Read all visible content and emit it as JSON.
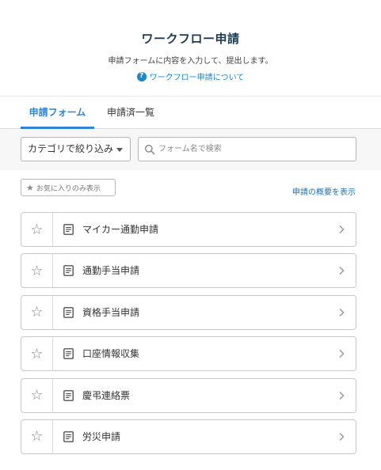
{
  "header": {
    "title": "ワークフロー申請",
    "subtitle": "申請フォームに内容を入力して、提出します。",
    "help_link": "ワークフロー申請について"
  },
  "tabs": [
    {
      "label": "申請フォーム",
      "active": true
    },
    {
      "label": "申請済一覧",
      "active": false
    }
  ],
  "filter": {
    "category_label": "カテゴリで絞り込み",
    "search_placeholder": "フォーム名で検索"
  },
  "favorites_filter_label": "お気に入りのみ表示",
  "overview_link": "申請の概要を表示",
  "forms": [
    {
      "label": "マイカー通勤申請"
    },
    {
      "label": "通勤手当申請"
    },
    {
      "label": "資格手当申請"
    },
    {
      "label": "口座情報収集"
    },
    {
      "label": "慶弔連絡票"
    },
    {
      "label": "労災申請"
    }
  ],
  "icons": {
    "help": "help-circle-icon",
    "search": "search-icon",
    "star": "star-outline-icon",
    "document": "document-icon",
    "chevron": "chevron-right-icon",
    "caret": "caret-down-icon"
  },
  "colors": {
    "accent": "#2f86d6",
    "link": "#1a72b8",
    "title": "#1f3a4f"
  }
}
